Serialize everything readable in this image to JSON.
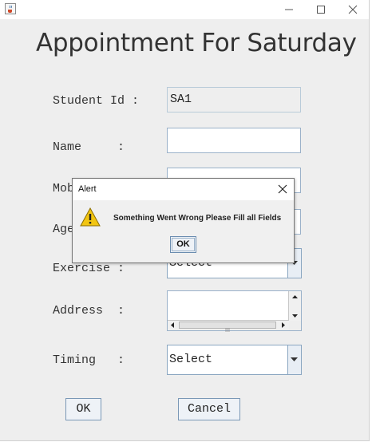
{
  "window": {
    "title_icon": "java-cup-icon",
    "controls": [
      "minimize-icon",
      "maximize-icon",
      "close-icon"
    ]
  },
  "form": {
    "heading": "Appointment For Saturday",
    "student_id": {
      "label": "Student Id :",
      "value": "SA1"
    },
    "name": {
      "label": "Name     :",
      "value": ""
    },
    "mobile": {
      "label": "Mob",
      "value": ""
    },
    "age": {
      "label": "Age",
      "value": ""
    },
    "exercise": {
      "label": "Exercise :",
      "value": "Select"
    },
    "address": {
      "label": "Address  :",
      "value": ""
    },
    "timing": {
      "label": "Timing   :",
      "value": "Select"
    },
    "ok_label": "OK",
    "cancel_label": "Cancel"
  },
  "dialog": {
    "title": "Alert",
    "message": "Something Went Wrong Please Fill all Fields",
    "ok_label": "OK",
    "icon": "warning-icon"
  },
  "colors": {
    "field_border": "#9ab1c9",
    "warning_fill": "#f2c511"
  }
}
